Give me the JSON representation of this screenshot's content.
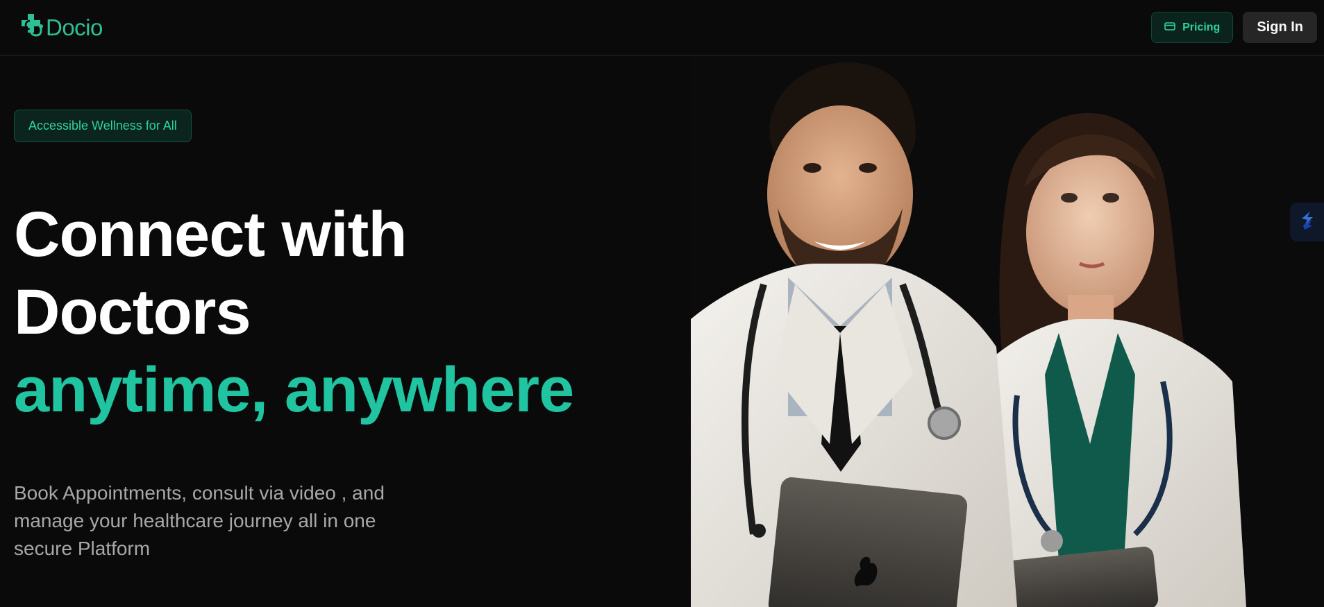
{
  "brand": {
    "name": "Docio",
    "accent": "#2fbf95"
  },
  "header": {
    "pricing_label": "Pricing",
    "pricing_icon": "credit-card-icon",
    "signin_label": "Sign In"
  },
  "hero": {
    "badge": "Accessible Wellness for All",
    "headline_line1": "Connect with",
    "headline_line2": "Doctors",
    "headline_accent": "anytime, anywhere",
    "subtitle": "Book Appointments, consult via video , and manage your healthcare journey all in one secure Platform"
  },
  "side_widget_icon": "lightning-icon",
  "colors": {
    "background": "#0a0a0a",
    "accent_text": "#21c4a0",
    "badge_text": "#2fd29c",
    "muted_text": "#a8a8a8"
  }
}
